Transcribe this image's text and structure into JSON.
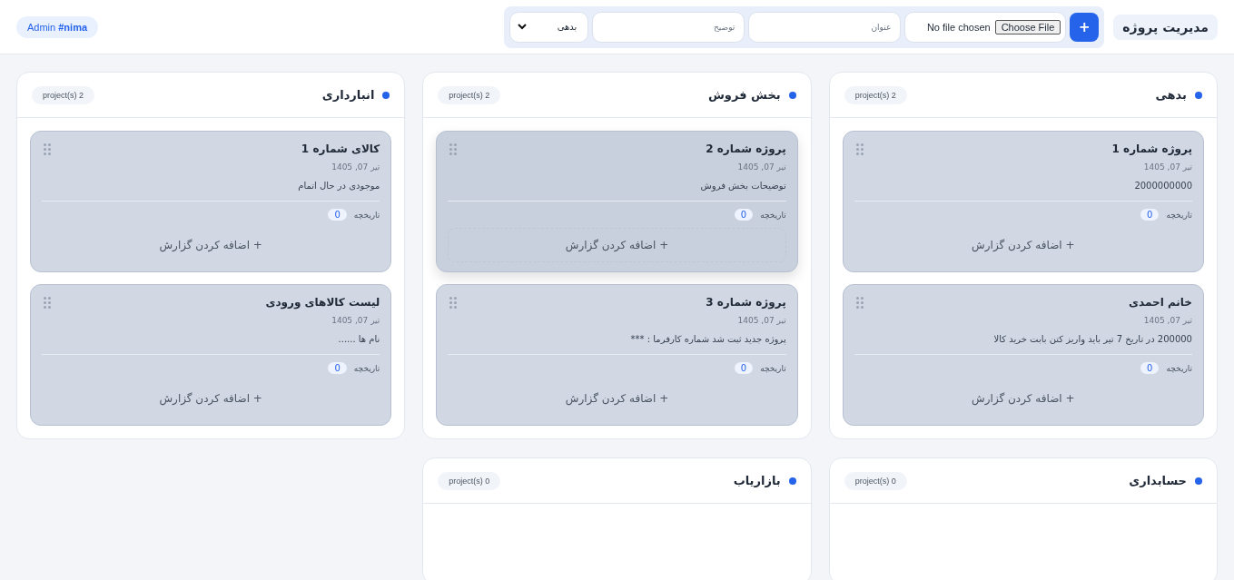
{
  "header": {
    "title": "مدیریت پروژه",
    "add_button": "+",
    "file_button": "Choose File",
    "file_status": "No file chosen",
    "title_placeholder": "عنوان",
    "description_placeholder": "توضیح",
    "category_select": "بدهی",
    "user_badge": {
      "role": "Admin",
      "name": "#nima"
    }
  },
  "columns": [
    {
      "title": "بدهی",
      "count": "project(s) 2",
      "color": "#2563eb",
      "cards": [
        {
          "title": "پروژه شماره 1",
          "date": "تیر 07, 1405",
          "description": "2000000000",
          "history_label": "تاریخچه",
          "history_count": "0",
          "add_report": "+ اضافه کردن گزارش",
          "highlighted": false
        },
        {
          "title": "خانم احمدی",
          "date": "تیر 07, 1405",
          "description": "200000 در تاریخ 7 تیر باید واریز کتن بابت خرید کالا",
          "history_label": "تاریخچه",
          "history_count": "0",
          "add_report": "+ اضافه کردن گزارش",
          "highlighted": false
        }
      ]
    },
    {
      "title": "بخش فروش",
      "count": "project(s) 2",
      "color": "#2563eb",
      "cards": [
        {
          "title": "پروژه شماره 2",
          "date": "تیر 07, 1405",
          "description": "توضیحات بخش فروش",
          "history_label": "تاریخچه",
          "history_count": "0",
          "add_report": "+ اضافه کردن گزارش",
          "highlighted": true
        },
        {
          "title": "پروژه شماره 3",
          "date": "تیر 07, 1405",
          "description": "پروژه جدید ثبت شد شماره کارفرما : ***",
          "history_label": "تاریخچه",
          "history_count": "0",
          "add_report": "+ اضافه کردن گزارش",
          "highlighted": false
        }
      ]
    },
    {
      "title": "انبارداری",
      "count": "project(s) 2",
      "color": "#2563eb",
      "cards": [
        {
          "title": "کالای شماره 1",
          "date": "تیر 07, 1405",
          "description": "موجودی در حال اتمام",
          "history_label": "تاریخچه",
          "history_count": "0",
          "add_report": "+ اضافه کردن گزارش",
          "highlighted": false
        },
        {
          "title": "لیست کالاهای ورودی",
          "date": "تیر 07, 1405",
          "description": "نام ها ......",
          "history_label": "تاریخچه",
          "history_count": "0",
          "add_report": "+ اضافه کردن گزارش",
          "highlighted": false
        }
      ]
    },
    {
      "title": "حسابداری",
      "count": "project(s) 0",
      "color": "#2563eb"
    },
    {
      "title": "بازاریاب",
      "count": "project(s) 0",
      "color": "#2563eb"
    }
  ]
}
